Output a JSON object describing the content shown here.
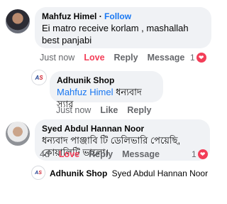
{
  "comment1": {
    "author": "Mahfuz Himel",
    "separator": "·",
    "follow_label": "Follow",
    "text": "Ei matro receive korlam , mashallah best panjabi",
    "time": "Just now",
    "love": "Love",
    "reply": "Reply",
    "message": "Message",
    "reaction_count": "1"
  },
  "comment2": {
    "author": "Adhunik Shop",
    "mention": "Mahfuz Himel",
    "text": "ধন্যবাদ স্যার",
    "time": "Just now",
    "like": "Like",
    "reply": "Reply"
  },
  "comment3": {
    "author": "Syed Abdul Hannan Noor",
    "text": "ধন্যবাদ পাঞ্জাবি টি ডেলিভারি পেয়েছি, কোয়ালিটি ভালো।",
    "time": "4d",
    "love": "Love",
    "reply": "Reply",
    "message": "Message",
    "reaction_count": "1"
  },
  "reply_preview": {
    "author": "Adhunik Shop",
    "text": "Syed Abdul Hannan Noor ধন্যবা..."
  },
  "logo_text": {
    "a": "A",
    "s": "S"
  },
  "colors": {
    "link": "#1877f2",
    "love": "#f33e58",
    "bubble": "#f0f2f5",
    "meta": "#65676b"
  },
  "icons": {
    "reaction": "heart-icon"
  }
}
